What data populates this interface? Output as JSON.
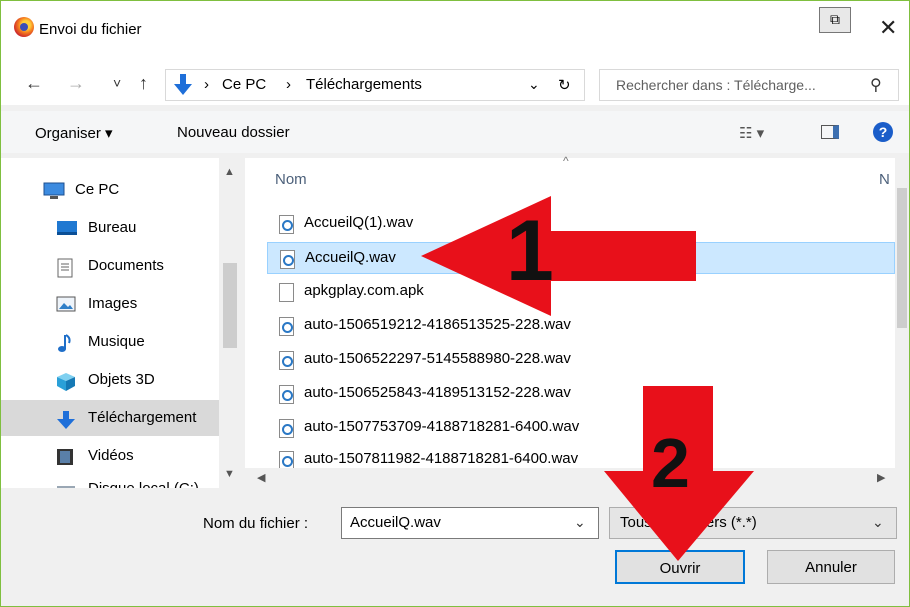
{
  "window": {
    "title": "Envoi du fichier",
    "restore_glyph": "⧉",
    "close_glyph": "✕"
  },
  "nav": {
    "back": "←",
    "forward": "→",
    "recent": "˅",
    "up": "↑",
    "breadcrumb": [
      "Ce PC",
      "Téléchargements"
    ],
    "separator": "›",
    "refresh": "↻",
    "dropdown": "⌄",
    "search_placeholder": "Rechercher dans : Télécharge...",
    "search_glyph": "⚲"
  },
  "toolbar": {
    "organize": "Organiser ▾",
    "new_folder": "Nouveau dossier",
    "view_glyph": "☷ ▾",
    "help": "?"
  },
  "sidebar": {
    "items": [
      {
        "label": "Ce PC",
        "icon": "pc-icon"
      },
      {
        "label": "Bureau",
        "icon": "desktop-icon"
      },
      {
        "label": "Documents",
        "icon": "documents-icon"
      },
      {
        "label": "Images",
        "icon": "images-icon"
      },
      {
        "label": "Musique",
        "icon": "music-icon"
      },
      {
        "label": "Objets 3D",
        "icon": "3d-objects-icon"
      },
      {
        "label": "Téléchargement",
        "icon": "downloads-icon",
        "selected": true
      },
      {
        "label": "Vidéos",
        "icon": "videos-icon"
      },
      {
        "label": "Disque local (C:)",
        "icon": "disk-icon"
      }
    ]
  },
  "files": {
    "column": "Nom",
    "column_next": "N",
    "rows": [
      {
        "name": "AccueilQ(1).wav",
        "type": "wav"
      },
      {
        "name": "AccueilQ.wav",
        "type": "wav",
        "selected": true
      },
      {
        "name": "apkgplay.com.apk",
        "type": "doc"
      },
      {
        "name": "auto-1506519212-4186513525-228.wav",
        "type": "wav"
      },
      {
        "name": "auto-1506522297-5145588980-228.wav",
        "type": "wav"
      },
      {
        "name": "auto-1506525843-4189513152-228.wav",
        "type": "wav"
      },
      {
        "name": "auto-1507753709-4188718281-6400.wav",
        "type": "wav"
      },
      {
        "name": "auto-1507811982-4188718281-6400.wav",
        "type": "wav"
      }
    ]
  },
  "bottom": {
    "filename_label": "Nom du fichier :",
    "filename_value": "AccueilQ.wav",
    "filter_value": "Tous les fichiers (*.*)",
    "open": "Ouvrir",
    "cancel": "Annuler"
  },
  "annotations": {
    "step1": "1",
    "step2": "2",
    "arrow_color": "#e8101a"
  }
}
